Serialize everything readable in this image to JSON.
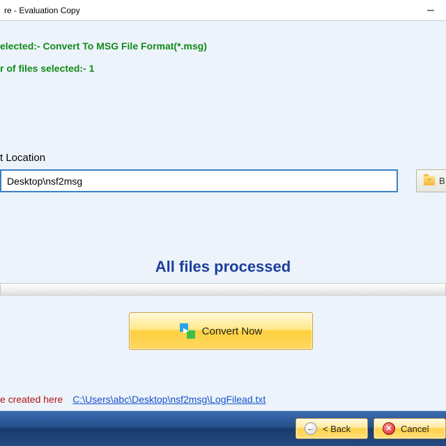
{
  "window": {
    "title_suffix": "re - Evaluation Copy"
  },
  "info": {
    "format_line": "elected:- Convert To MSG File Format(*.msg)",
    "count_line": "r of files selected:- 1"
  },
  "output": {
    "section_label": "t Location",
    "path_value": "Desktop\\nsf2msg",
    "browse_label": "B"
  },
  "status": {
    "text": "All files processed"
  },
  "actions": {
    "convert_label": "Convert Now"
  },
  "log": {
    "label": "e created here",
    "link": "C:\\Users\\abc\\Desktop\\nsf2msg\\LogFilead.txt"
  },
  "footer": {
    "back_label": "< Back",
    "cancel_label": "Cancel"
  }
}
